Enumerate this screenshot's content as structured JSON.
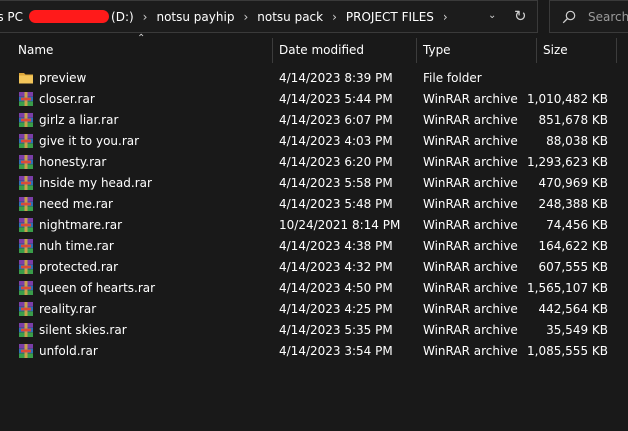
{
  "address": {
    "crumbs": [
      "is PC",
      "(D:)",
      "notsu payhip",
      "notsu pack",
      "PROJECT FILES"
    ],
    "separator": "›"
  },
  "search": {
    "placeholder": "Search"
  },
  "columns": {
    "name": "Name",
    "date": "Date modified",
    "type": "Type",
    "size": "Size"
  },
  "files": [
    {
      "name": "preview",
      "date": "4/14/2023 8:39 PM",
      "type": "File folder",
      "size": "",
      "icon": "folder-icon"
    },
    {
      "name": "closer.rar",
      "date": "4/14/2023 5:44 PM",
      "type": "WinRAR archive",
      "size": "1,010,482 KB",
      "icon": "winrar-archive-icon"
    },
    {
      "name": "girlz a liar.rar",
      "date": "4/14/2023 6:07 PM",
      "type": "WinRAR archive",
      "size": "851,678 KB",
      "icon": "winrar-archive-icon"
    },
    {
      "name": "give it to you.rar",
      "date": "4/14/2023 4:03 PM",
      "type": "WinRAR archive",
      "size": "88,038 KB",
      "icon": "winrar-archive-icon"
    },
    {
      "name": "honesty.rar",
      "date": "4/14/2023 6:20 PM",
      "type": "WinRAR archive",
      "size": "1,293,623 KB",
      "icon": "winrar-archive-icon"
    },
    {
      "name": "inside my head.rar",
      "date": "4/14/2023 5:58 PM",
      "type": "WinRAR archive",
      "size": "470,969 KB",
      "icon": "winrar-archive-icon"
    },
    {
      "name": "need me.rar",
      "date": "4/14/2023 5:48 PM",
      "type": "WinRAR archive",
      "size": "248,388 KB",
      "icon": "winrar-archive-icon"
    },
    {
      "name": "nightmare.rar",
      "date": "10/24/2021 8:14 PM",
      "type": "WinRAR archive",
      "size": "74,456 KB",
      "icon": "winrar-archive-icon"
    },
    {
      "name": "nuh time.rar",
      "date": "4/14/2023 4:38 PM",
      "type": "WinRAR archive",
      "size": "164,622 KB",
      "icon": "winrar-archive-icon"
    },
    {
      "name": "protected.rar",
      "date": "4/14/2023 4:32 PM",
      "type": "WinRAR archive",
      "size": "607,555 KB",
      "icon": "winrar-archive-icon"
    },
    {
      "name": "queen of hearts.rar",
      "date": "4/14/2023 4:50 PM",
      "type": "WinRAR archive",
      "size": "1,565,107 KB",
      "icon": "winrar-archive-icon"
    },
    {
      "name": "reality.rar",
      "date": "4/14/2023 4:25 PM",
      "type": "WinRAR archive",
      "size": "442,564 KB",
      "icon": "winrar-archive-icon"
    },
    {
      "name": "silent skies.rar",
      "date": "4/14/2023 5:35 PM",
      "type": "WinRAR archive",
      "size": "35,549 KB",
      "icon": "winrar-archive-icon"
    },
    {
      "name": "unfold.rar",
      "date": "4/14/2023 3:54 PM",
      "type": "WinRAR archive",
      "size": "1,085,555 KB",
      "icon": "winrar-archive-icon"
    }
  ],
  "colors": {
    "background": "#191919",
    "text": "#ffffff",
    "redaction": "#ff1a1a",
    "folder": "#e8b84a"
  }
}
